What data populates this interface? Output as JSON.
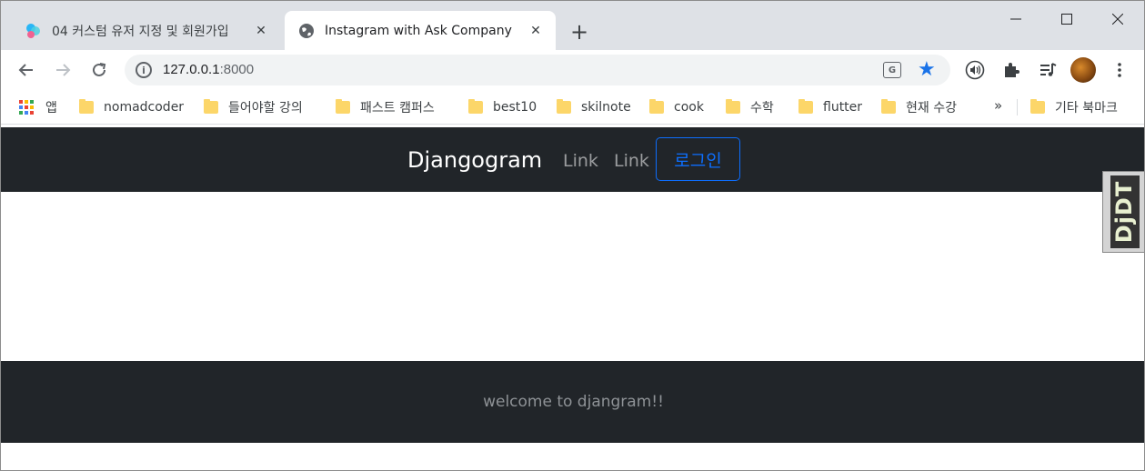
{
  "browser": {
    "tabs": [
      {
        "title": "04 커스텀 유저 지정 및 회원가입",
        "active": false,
        "favicon": "colorful-app-icon"
      },
      {
        "title": "Instagram with Ask Company",
        "active": true,
        "favicon": "globe-icon"
      }
    ],
    "new_tab_glyph": "+",
    "address": {
      "host": "127.0.0.1",
      "port": ":8000"
    },
    "bookmarks": [
      {
        "label": "앱",
        "icon": "apps-grid-icon"
      },
      {
        "label": "nomadcoder",
        "icon": "folder-icon"
      },
      {
        "label": "들어야할 강의",
        "icon": "folder-icon"
      },
      {
        "label": "패스트 캠퍼스",
        "icon": "folder-icon"
      },
      {
        "label": "best10",
        "icon": "folder-icon"
      },
      {
        "label": "skilnote",
        "icon": "folder-icon"
      },
      {
        "label": "cook",
        "icon": "folder-icon"
      },
      {
        "label": "수학",
        "icon": "folder-icon"
      },
      {
        "label": "flutter",
        "icon": "folder-icon"
      },
      {
        "label": "현재 수강",
        "icon": "folder-icon"
      },
      {
        "label": "기타 북마크",
        "icon": "folder-icon"
      }
    ],
    "bookmarks_overflow": "»"
  },
  "page": {
    "navbar": {
      "brand": "Djangogram",
      "links": [
        "Link",
        "Link"
      ],
      "login_label": "로그인"
    },
    "debug_toolbar_label": "DjDT",
    "footer_text": "welcome to djangram!!"
  },
  "colors": {
    "navbar_bg": "#212529",
    "login_accent": "#0d6efd",
    "star_blue": "#1a73e8",
    "folder_yellow": "#fcd669"
  }
}
